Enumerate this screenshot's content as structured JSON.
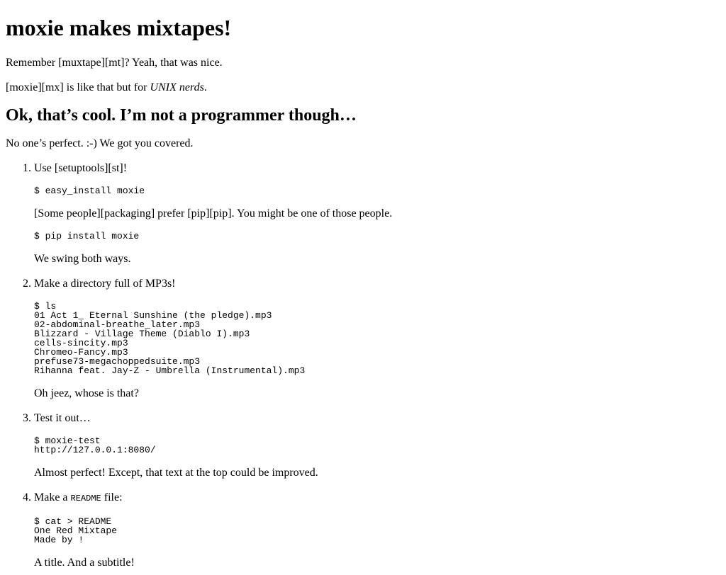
{
  "title": "moxie makes mixtapes!",
  "intro": {
    "p1": "Remember [muxtape][mt]? Yeah, that was nice.",
    "p2_prefix": "[moxie][mx] is like that but for ",
    "p2_em": "UNIX nerds",
    "p2_suffix": "."
  },
  "section2": {
    "heading": "Ok, that’s cool. I’m not a programmer though…",
    "lead": "No one’s perfect. :-) We got you covered."
  },
  "steps": [
    {
      "number": "1.",
      "lead": "Use [setuptools][st]!",
      "code1": "$ easy_install moxie",
      "text1": "[Some people][packaging] prefer [pip][pip]. You might be one of those people.",
      "code2": "$ pip install moxie",
      "text2": "We swing both ways."
    },
    {
      "number": "2.",
      "lead": "Make a directory full of MP3s!",
      "code": "$ ls\n01 Act 1_ Eternal Sunshine (the pledge).mp3\n02-abdominal-breathe_later.mp3\nBlizzard - Village Theme (Diablo I).mp3\ncells-sincity.mp3\nChromeo-Fancy.mp3\nprefuse73-megachoppedsuite.mp3\nRihanna feat. Jay-Z - Umbrella (Instrumental).mp3",
      "text": "Oh jeez, whose is that?"
    },
    {
      "number": "3.",
      "lead": "Test it out…",
      "code": "$ moxie-test\nhttp://127.0.0.1:8080/",
      "text": "Almost perfect! Except, that text at the top could be improved."
    },
    {
      "number": "4.",
      "lead_prefix": "Make a ",
      "lead_code": "README",
      "lead_suffix": " file:",
      "code": "$ cat > README\nOne Red Mixtape\nMade by !",
      "text": "A title. And a subtitle!"
    }
  ]
}
